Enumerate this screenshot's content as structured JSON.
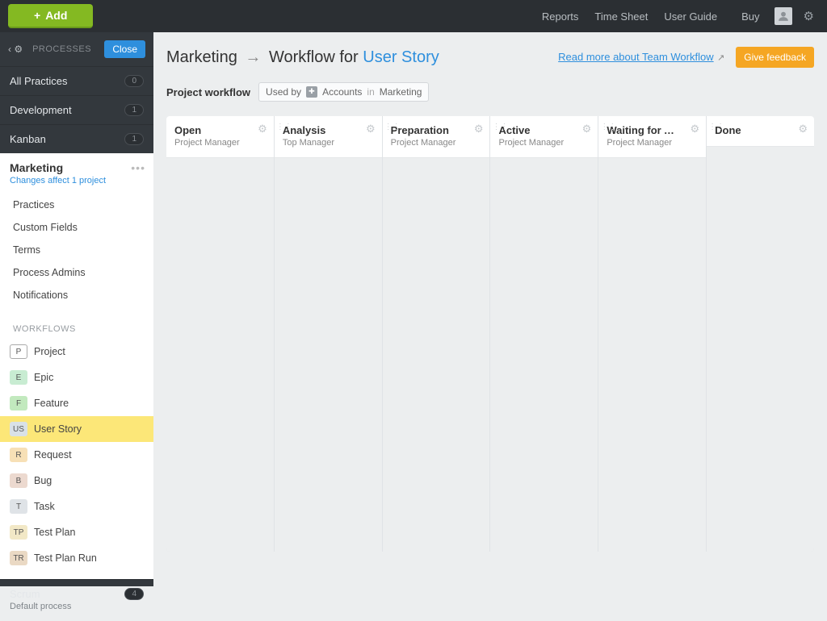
{
  "topbar": {
    "add_label": "Add",
    "links": [
      "Reports",
      "Time Sheet",
      "User Guide",
      "Buy"
    ]
  },
  "sidebar": {
    "top_label": "PROCESSES",
    "close_label": "Close",
    "categories": [
      {
        "label": "All Practices",
        "count": "0"
      },
      {
        "label": "Development",
        "count": "1"
      },
      {
        "label": "Kanban",
        "count": "1"
      }
    ],
    "panel": {
      "title": "Marketing",
      "subtitle": "Changes affect 1 project",
      "items": [
        "Practices",
        "Custom Fields",
        "Terms",
        "Process Admins",
        "Notifications"
      ],
      "workflows_label": "WORKFLOWS",
      "workflows": [
        {
          "badge": "P",
          "cls": "wf-p",
          "label": "Project"
        },
        {
          "badge": "E",
          "cls": "wf-e",
          "label": "Epic"
        },
        {
          "badge": "F",
          "cls": "wf-f",
          "label": "Feature"
        },
        {
          "badge": "US",
          "cls": "wf-us",
          "label": "User Story",
          "active": true
        },
        {
          "badge": "R",
          "cls": "wf-r",
          "label": "Request"
        },
        {
          "badge": "B",
          "cls": "wf-b",
          "label": "Bug"
        },
        {
          "badge": "T",
          "cls": "wf-t",
          "label": "Task"
        },
        {
          "badge": "TP",
          "cls": "wf-tp",
          "label": "Test Plan"
        },
        {
          "badge": "TR",
          "cls": "wf-tr",
          "label": "Test Plan Run"
        }
      ]
    },
    "bottom": {
      "title": "Scrum",
      "subtitle": "Default process",
      "count": "4"
    }
  },
  "content": {
    "crumb": {
      "root": "Marketing",
      "mid": "Workflow for",
      "entity": "User Story"
    },
    "team_link": "Read more about Team Workflow",
    "feedback_label": "Give feedback",
    "subhead_label": "Project workflow",
    "usedby_prefix": "Used by",
    "usedby_accounts": "Accounts",
    "usedby_in": "in",
    "usedby_project": "Marketing",
    "columns": [
      {
        "title": "Open",
        "role": "Project Manager"
      },
      {
        "title": "Analysis",
        "role": "Top Manager"
      },
      {
        "title": "Preparation",
        "role": "Project Manager"
      },
      {
        "title": "Active",
        "role": "Project Manager"
      },
      {
        "title": "Waiting for Ap…",
        "role": "Project Manager"
      },
      {
        "title": "Done",
        "role": ""
      }
    ]
  }
}
